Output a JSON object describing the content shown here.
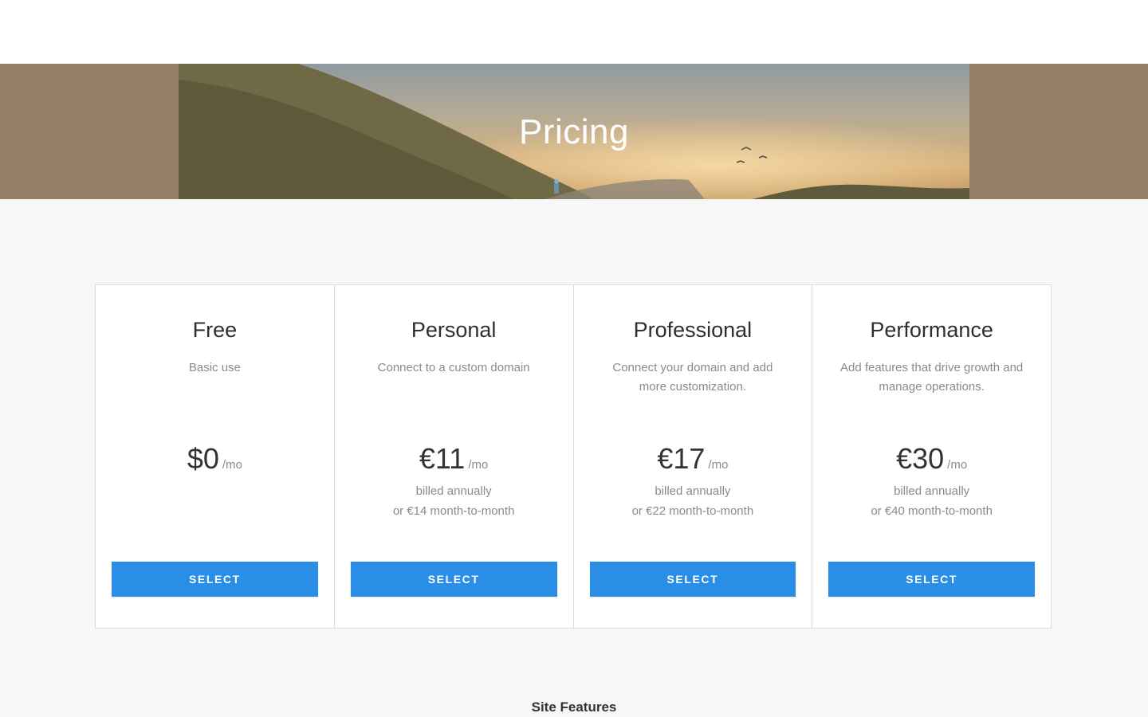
{
  "hero": {
    "title": "Pricing"
  },
  "plans": [
    {
      "name": "Free",
      "description": "Basic use",
      "price": "$0",
      "period": "/mo",
      "billing_line1": "",
      "billing_line2": "",
      "button_label": "SELECT"
    },
    {
      "name": "Personal",
      "description": "Connect to a custom domain",
      "price": "€11",
      "period": "/mo",
      "billing_line1": "billed annually",
      "billing_line2": "or €14 month-to-month",
      "button_label": "SELECT"
    },
    {
      "name": "Professional",
      "description": "Connect your domain and add more customization.",
      "price": "€17",
      "period": "/mo",
      "billing_line1": "billed annually",
      "billing_line2": "or €22 month-to-month",
      "button_label": "SELECT"
    },
    {
      "name": "Performance",
      "description": "Add features that drive growth and manage operations.",
      "price": "€30",
      "period": "/mo",
      "billing_line1": "billed annually",
      "billing_line2": "or €40 month-to-month",
      "button_label": "SELECT"
    }
  ],
  "features": {
    "heading": "Site Features"
  },
  "colors": {
    "accent": "#2a8ee6",
    "hero_side": "#927f66",
    "background": "#f7f7f7"
  }
}
